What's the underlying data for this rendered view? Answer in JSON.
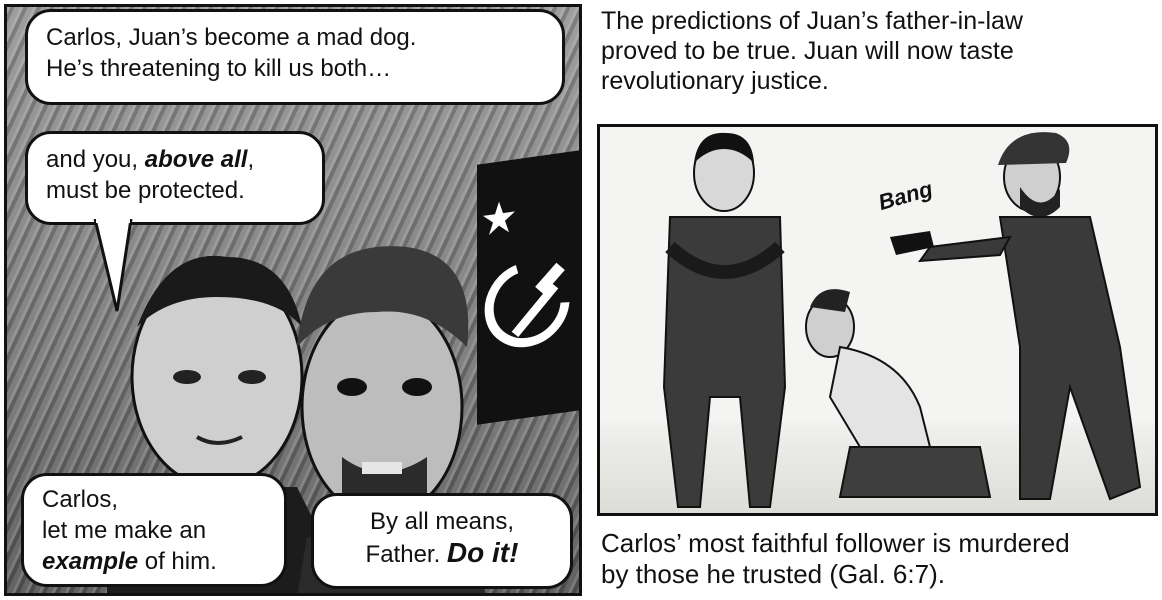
{
  "left_panel": {
    "bubble1": {
      "line1": "Carlos, Juan’s become a mad dog.",
      "line2": "He’s threatening to kill us both…"
    },
    "bubble2": {
      "line1_pre": "and you, ",
      "line1_emph": "above all",
      "line1_post": ",",
      "line2": "must be protected."
    },
    "bubble3": {
      "line1": "Carlos,",
      "line2": "let me make an",
      "line3_emph": "example",
      "line3_post": " of him."
    },
    "bubble4": {
      "line1": "By all means,",
      "line2_pre": "Father. ",
      "line2_emph": "Do it!"
    }
  },
  "right_panel": {
    "caption_top": {
      "line1": "The predictions of Juan’s father-in-law",
      "line2": "proved to be true.  Juan will now taste",
      "line3": "revolutionary justice."
    },
    "sound_effect": "Bang",
    "caption_bottom": {
      "line1": "Carlos’ most faithful follower is murdered",
      "line2": "by those he trusted (Gal. 6:7)."
    }
  }
}
